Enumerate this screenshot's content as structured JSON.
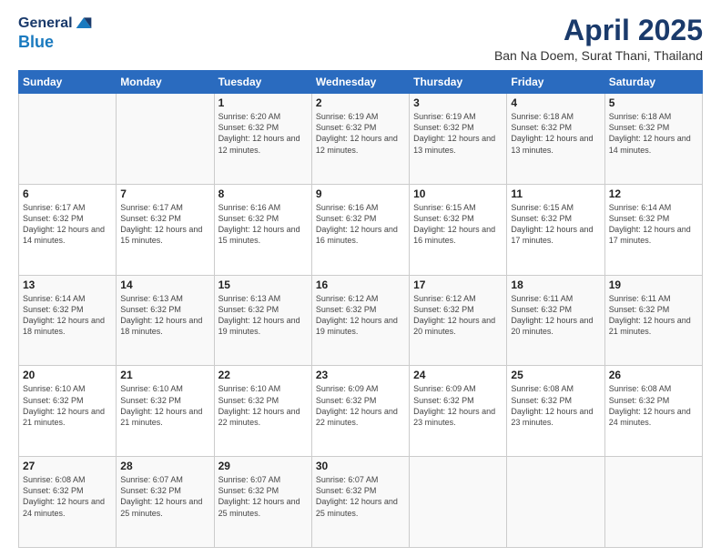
{
  "header": {
    "logo_line1": "General",
    "logo_line2": "Blue",
    "month_title": "April 2025",
    "location": "Ban Na Doem, Surat Thani, Thailand"
  },
  "weekdays": [
    "Sunday",
    "Monday",
    "Tuesday",
    "Wednesday",
    "Thursday",
    "Friday",
    "Saturday"
  ],
  "weeks": [
    [
      {
        "day": "",
        "info": ""
      },
      {
        "day": "",
        "info": ""
      },
      {
        "day": "1",
        "info": "Sunrise: 6:20 AM\nSunset: 6:32 PM\nDaylight: 12 hours and 12 minutes."
      },
      {
        "day": "2",
        "info": "Sunrise: 6:19 AM\nSunset: 6:32 PM\nDaylight: 12 hours and 12 minutes."
      },
      {
        "day": "3",
        "info": "Sunrise: 6:19 AM\nSunset: 6:32 PM\nDaylight: 12 hours and 13 minutes."
      },
      {
        "day": "4",
        "info": "Sunrise: 6:18 AM\nSunset: 6:32 PM\nDaylight: 12 hours and 13 minutes."
      },
      {
        "day": "5",
        "info": "Sunrise: 6:18 AM\nSunset: 6:32 PM\nDaylight: 12 hours and 14 minutes."
      }
    ],
    [
      {
        "day": "6",
        "info": "Sunrise: 6:17 AM\nSunset: 6:32 PM\nDaylight: 12 hours and 14 minutes."
      },
      {
        "day": "7",
        "info": "Sunrise: 6:17 AM\nSunset: 6:32 PM\nDaylight: 12 hours and 15 minutes."
      },
      {
        "day": "8",
        "info": "Sunrise: 6:16 AM\nSunset: 6:32 PM\nDaylight: 12 hours and 15 minutes."
      },
      {
        "day": "9",
        "info": "Sunrise: 6:16 AM\nSunset: 6:32 PM\nDaylight: 12 hours and 16 minutes."
      },
      {
        "day": "10",
        "info": "Sunrise: 6:15 AM\nSunset: 6:32 PM\nDaylight: 12 hours and 16 minutes."
      },
      {
        "day": "11",
        "info": "Sunrise: 6:15 AM\nSunset: 6:32 PM\nDaylight: 12 hours and 17 minutes."
      },
      {
        "day": "12",
        "info": "Sunrise: 6:14 AM\nSunset: 6:32 PM\nDaylight: 12 hours and 17 minutes."
      }
    ],
    [
      {
        "day": "13",
        "info": "Sunrise: 6:14 AM\nSunset: 6:32 PM\nDaylight: 12 hours and 18 minutes."
      },
      {
        "day": "14",
        "info": "Sunrise: 6:13 AM\nSunset: 6:32 PM\nDaylight: 12 hours and 18 minutes."
      },
      {
        "day": "15",
        "info": "Sunrise: 6:13 AM\nSunset: 6:32 PM\nDaylight: 12 hours and 19 minutes."
      },
      {
        "day": "16",
        "info": "Sunrise: 6:12 AM\nSunset: 6:32 PM\nDaylight: 12 hours and 19 minutes."
      },
      {
        "day": "17",
        "info": "Sunrise: 6:12 AM\nSunset: 6:32 PM\nDaylight: 12 hours and 20 minutes."
      },
      {
        "day": "18",
        "info": "Sunrise: 6:11 AM\nSunset: 6:32 PM\nDaylight: 12 hours and 20 minutes."
      },
      {
        "day": "19",
        "info": "Sunrise: 6:11 AM\nSunset: 6:32 PM\nDaylight: 12 hours and 21 minutes."
      }
    ],
    [
      {
        "day": "20",
        "info": "Sunrise: 6:10 AM\nSunset: 6:32 PM\nDaylight: 12 hours and 21 minutes."
      },
      {
        "day": "21",
        "info": "Sunrise: 6:10 AM\nSunset: 6:32 PM\nDaylight: 12 hours and 21 minutes."
      },
      {
        "day": "22",
        "info": "Sunrise: 6:10 AM\nSunset: 6:32 PM\nDaylight: 12 hours and 22 minutes."
      },
      {
        "day": "23",
        "info": "Sunrise: 6:09 AM\nSunset: 6:32 PM\nDaylight: 12 hours and 22 minutes."
      },
      {
        "day": "24",
        "info": "Sunrise: 6:09 AM\nSunset: 6:32 PM\nDaylight: 12 hours and 23 minutes."
      },
      {
        "day": "25",
        "info": "Sunrise: 6:08 AM\nSunset: 6:32 PM\nDaylight: 12 hours and 23 minutes."
      },
      {
        "day": "26",
        "info": "Sunrise: 6:08 AM\nSunset: 6:32 PM\nDaylight: 12 hours and 24 minutes."
      }
    ],
    [
      {
        "day": "27",
        "info": "Sunrise: 6:08 AM\nSunset: 6:32 PM\nDaylight: 12 hours and 24 minutes."
      },
      {
        "day": "28",
        "info": "Sunrise: 6:07 AM\nSunset: 6:32 PM\nDaylight: 12 hours and 25 minutes."
      },
      {
        "day": "29",
        "info": "Sunrise: 6:07 AM\nSunset: 6:32 PM\nDaylight: 12 hours and 25 minutes."
      },
      {
        "day": "30",
        "info": "Sunrise: 6:07 AM\nSunset: 6:32 PM\nDaylight: 12 hours and 25 minutes."
      },
      {
        "day": "",
        "info": ""
      },
      {
        "day": "",
        "info": ""
      },
      {
        "day": "",
        "info": ""
      }
    ]
  ]
}
